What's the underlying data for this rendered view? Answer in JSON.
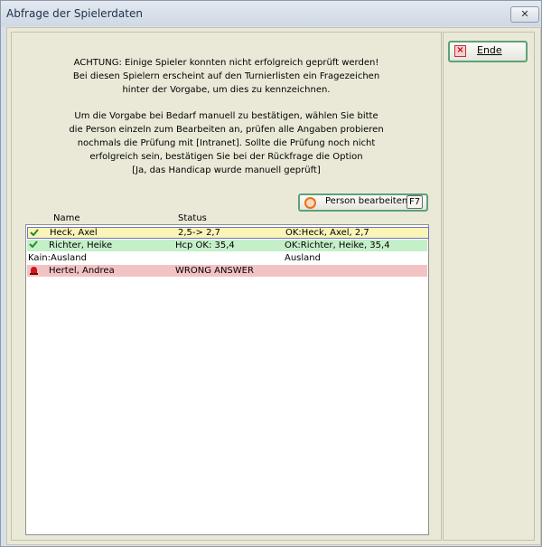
{
  "window": {
    "title": "Abfrage der Spielerdaten",
    "close_glyph": "✕"
  },
  "side": {
    "ende_label": "Ende",
    "ende_icon": "close-x-icon"
  },
  "notice": {
    "lines1": [
      "ACHTUNG: Einige Spieler konnten nicht erfolgreich geprüft werden!",
      "Bei diesen Spielern erscheint auf den Turnierlisten ein Fragezeichen",
      "hinter der Vorgabe, um dies zu kennzeichnen."
    ],
    "lines2": [
      "Um die Vorgabe bei Bedarf manuell zu bestätigen, wählen Sie bitte",
      "die Person einzeln zum Bearbeiten an, prüfen alle Angaben probieren",
      "nochmals die Prüfung mit [Intranet]. Sollte die Prüfung noch nicht",
      "erfolgreich sein, bestätigen Sie bei der Rückfrage die Option",
      "[Ja, das Handicap wurde manuell geprüft]"
    ]
  },
  "person_button": {
    "label": "Person bearbeiten",
    "key": "F7"
  },
  "list": {
    "headers": {
      "name": "Name",
      "status": "Status"
    },
    "rows": [
      {
        "icon": "checkmark-icon",
        "name": "Heck, Axel",
        "status": "2,5-> 2,7",
        "result": "OK:Heck, Axel, 2,7"
      },
      {
        "icon": "checkmark-icon",
        "name": "Richter, Heike",
        "status": "Hcp OK: 35,4",
        "result": "OK:Richter, Heike, 35,4"
      },
      {
        "icon": "",
        "name": "Kain:Ausland",
        "status": "",
        "result": "Ausland"
      },
      {
        "icon": "alarm-bell-icon",
        "name": "Hertel, Andrea",
        "status": "WRONG ANSWER",
        "result": ""
      }
    ]
  },
  "colors": {
    "row_selected": "#fbf4b7",
    "row_ok": "#c4efc8",
    "row_error": "#f3c2c3",
    "button_border": "#5aa376"
  }
}
